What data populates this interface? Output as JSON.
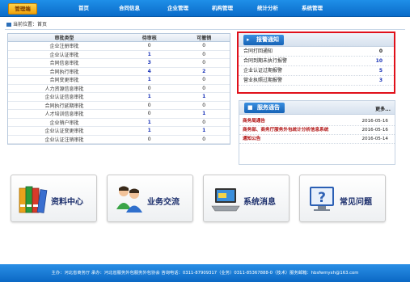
{
  "nav": {
    "logo": "管理端",
    "items": [
      "首页",
      "合同信息",
      "企业管理",
      "机构管理",
      "统计分析",
      "系统管理"
    ]
  },
  "breadcrumb": "当前位置：首页",
  "audit_table": {
    "headers": [
      "审批类型",
      "待审核",
      "可撤销"
    ],
    "rows": [
      [
        "企业注册审批",
        "0",
        "0"
      ],
      [
        "企业认证审批",
        "1",
        "0"
      ],
      [
        "合同信息审批",
        "3",
        "0"
      ],
      [
        "合同执行审批",
        "4",
        "2"
      ],
      [
        "合同变更审批",
        "1",
        "0"
      ],
      [
        "人力资源信息审批",
        "0",
        "0"
      ],
      [
        "企业认证信息审批",
        "1",
        "1"
      ],
      [
        "合同执行延期审批",
        "0",
        "0"
      ],
      [
        "人才培训信息审批",
        "0",
        "1"
      ],
      [
        "企业销户审批",
        "1",
        "0"
      ],
      [
        "企业认证变更审批",
        "1",
        "1"
      ],
      [
        "企业认证注销审批",
        "0",
        "0"
      ]
    ]
  },
  "notify": {
    "title": "报警通知",
    "items": [
      {
        "label": "合同打回通知",
        "value": "0",
        "style": "black"
      },
      {
        "label": "合同到期未执行报警",
        "value": "10",
        "style": "blue"
      },
      {
        "label": "企业认证过期报警",
        "value": "5",
        "style": "blue"
      },
      {
        "label": "营业执照过期报警",
        "value": "3",
        "style": "blue"
      }
    ]
  },
  "service": {
    "title": "服务通告",
    "more": "更多...",
    "items": [
      {
        "title": "商务局通告",
        "date": "2016-05-16"
      },
      {
        "title": "商务部、商务厅服务外包统计分析信息系统",
        "date": "2016-05-16"
      },
      {
        "title": "通知公告",
        "date": "2016-05-14"
      }
    ]
  },
  "buttons": [
    {
      "label": "资料中心",
      "icon": "binders-icon"
    },
    {
      "label": "业务交流",
      "icon": "users-icon"
    },
    {
      "label": "系统消息",
      "icon": "laptop-icon"
    },
    {
      "label": "常见问题",
      "icon": "question-icon"
    }
  ],
  "footer": "主办：河北省商务厅 承办：河北省服务外包服务外包协会 咨询电话：0311-87909317（业务）0311-85367888-0（技术）服务邮箱：hbsfwmyxh@163.com",
  "colors": {
    "nav_blue": "#0a6cc9",
    "alert_border": "#e0101a",
    "count_blue": "#1a33b8",
    "logo_gold": "#f0a30a"
  }
}
